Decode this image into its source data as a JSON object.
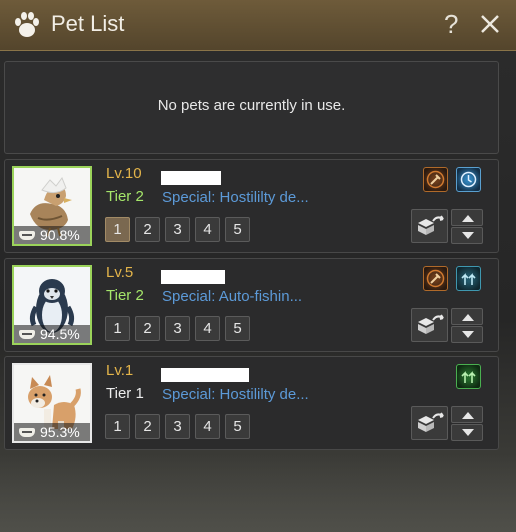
{
  "window": {
    "title": "Pet List",
    "help_label": "?",
    "paw_icon": "paw-icon",
    "close_icon": "close-icon"
  },
  "notice": {
    "text": "No pets are currently in use."
  },
  "pets": [
    {
      "level": "Lv.10",
      "tier": "Tier 2",
      "special": "Special: Hostililty de...",
      "hunger": "90.8%",
      "portrait": "baby-bird-in-eggshell",
      "slots": [
        "1",
        "2",
        "3",
        "4",
        "5"
      ],
      "active_slot": "1",
      "skill_icons": [
        "hammer-skill-icon",
        "clock-skill-icon"
      ]
    },
    {
      "level": "Lv.5",
      "tier": "Tier 2",
      "special": "Special: Auto-fishin...",
      "hunger": "94.5%",
      "portrait": "penguin",
      "slots": [
        "1",
        "2",
        "3",
        "4",
        "5"
      ],
      "active_slot": "",
      "skill_icons": [
        "hammer-skill-icon",
        "up-arrows-skill-icon"
      ]
    },
    {
      "level": "Lv.1",
      "tier": "Tier 1",
      "special": "Special: Hostililty de...",
      "hunger": "95.3%",
      "portrait": "shiba-dog",
      "slots": [
        "1",
        "2",
        "3",
        "4",
        "5"
      ],
      "active_slot": "",
      "skill_icons": [
        "green-up-arrows-skill-icon"
      ]
    }
  ],
  "colors": {
    "titlebar": "#6e5b3a",
    "level_text": "#e3b44a",
    "tier_green": "#a5e66a",
    "special_text": "#5c9ad8",
    "active_slot": "#7a6850"
  }
}
